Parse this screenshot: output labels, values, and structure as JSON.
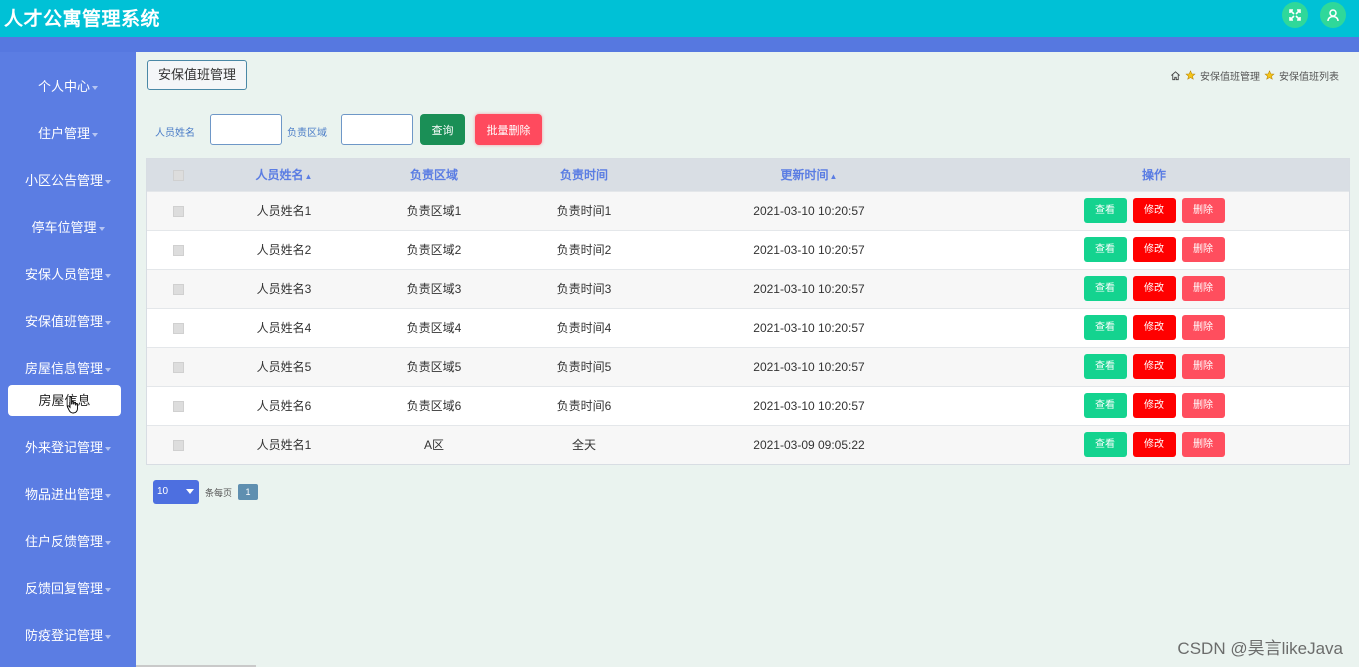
{
  "header": {
    "title": "人才公寓管理系统"
  },
  "sidebar": {
    "items": [
      {
        "label": "个人中心"
      },
      {
        "label": "住户管理"
      },
      {
        "label": "小区公告管理"
      },
      {
        "label": "停车位管理"
      },
      {
        "label": "安保人员管理"
      },
      {
        "label": "安保值班管理"
      },
      {
        "label": "房屋信息管理"
      },
      {
        "label": "外来登记管理"
      },
      {
        "label": "物品进出管理"
      },
      {
        "label": "住户反馈管理"
      },
      {
        "label": "反馈回复管理"
      },
      {
        "label": "防疫登记管理"
      }
    ],
    "submenu_open": "房屋信息"
  },
  "page": {
    "title": "安保值班管理"
  },
  "breadcrumb": {
    "first": "安保值班管理",
    "second": "安保值班列表"
  },
  "search": {
    "name_label": "人员姓名",
    "name_value": "",
    "area_label": "负责区域",
    "area_value": "",
    "query_button": "查询",
    "batch_delete_button": "批量删除"
  },
  "table": {
    "headers": [
      "人员姓名",
      "负责区域",
      "负责时间",
      "更新时间",
      "操作"
    ],
    "rows": [
      {
        "name": "人员姓名1",
        "area": "负责区域1",
        "time": "负责时间1",
        "updated": "2021-03-10 10:20:57"
      },
      {
        "name": "人员姓名2",
        "area": "负责区域2",
        "time": "负责时间2",
        "updated": "2021-03-10 10:20:57"
      },
      {
        "name": "人员姓名3",
        "area": "负责区域3",
        "time": "负责时间3",
        "updated": "2021-03-10 10:20:57"
      },
      {
        "name": "人员姓名4",
        "area": "负责区域4",
        "time": "负责时间4",
        "updated": "2021-03-10 10:20:57"
      },
      {
        "name": "人员姓名5",
        "area": "负责区域5",
        "time": "负责时间5",
        "updated": "2021-03-10 10:20:57"
      },
      {
        "name": "人员姓名6",
        "area": "负责区域6",
        "time": "负责时间6",
        "updated": "2021-03-10 10:20:57"
      },
      {
        "name": "人员姓名1",
        "area": "A区",
        "time": "全天",
        "updated": "2021-03-09 09:05:22"
      }
    ],
    "actions": {
      "view": "查看",
      "edit": "修改",
      "delete": "删除"
    }
  },
  "pagination": {
    "page_size": "10",
    "per_page_label": "条每页",
    "current_page": "1"
  },
  "watermark": "CSDN @昊言likeJava",
  "colors": {
    "header": "#00c1d6",
    "sidebar": "#5b7de3",
    "query": "#1a8f56",
    "batch_delete": "#ff4a5e",
    "view": "#14d38f",
    "edit": "#ff0000",
    "delete": "#ff4e5e"
  }
}
